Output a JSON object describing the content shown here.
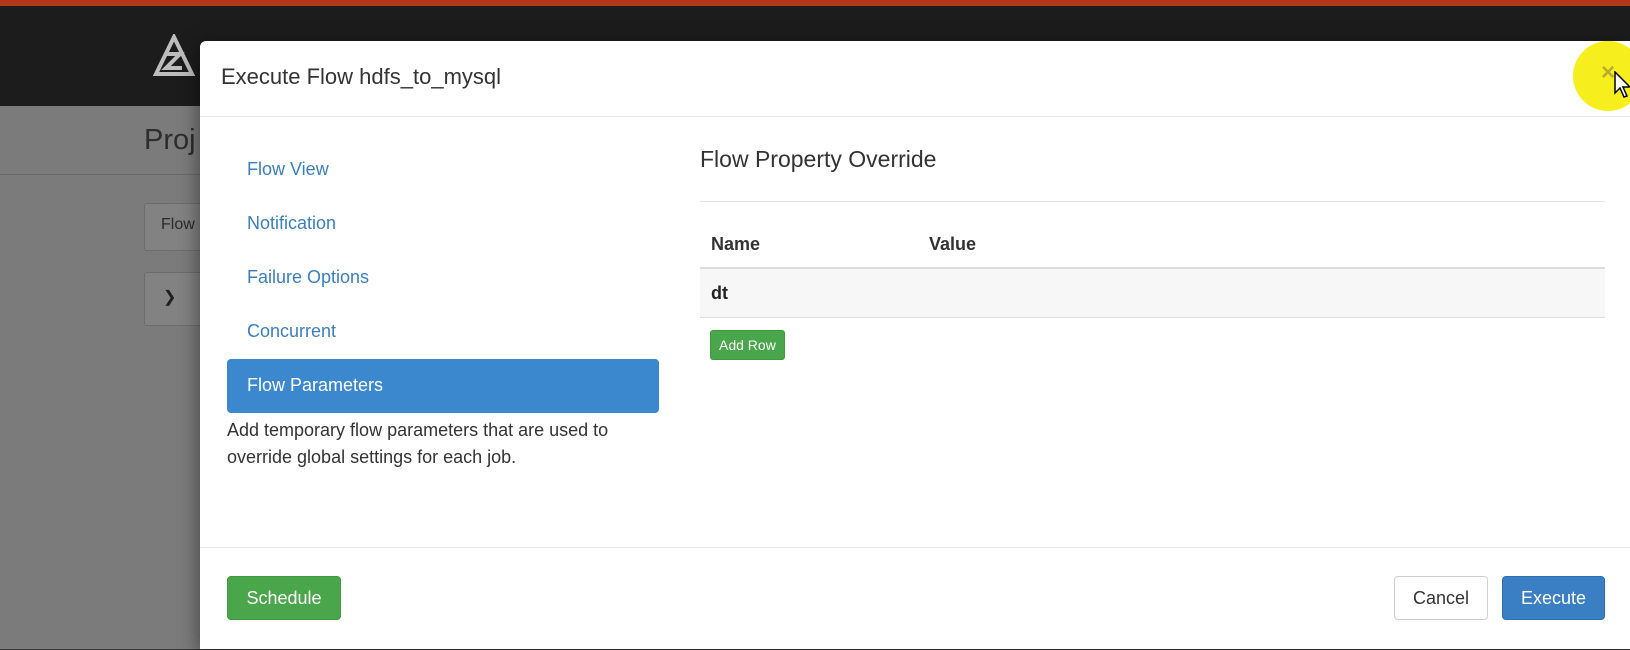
{
  "background": {
    "page_title": "Proj",
    "tab_label": "Flow"
  },
  "modal": {
    "title": "Execute Flow hdfs_to_mysql",
    "close_label": "×",
    "nav": [
      {
        "label": "Flow View"
      },
      {
        "label": "Notification"
      },
      {
        "label": "Failure Options"
      },
      {
        "label": "Concurrent"
      },
      {
        "label": "Flow Parameters",
        "active": true
      }
    ],
    "nav_help": "Add temporary flow parameters that are used to override global settings for each job.",
    "content": {
      "title": "Flow Property Override",
      "columns": [
        "Name",
        "Value"
      ],
      "rows": [
        {
          "name": "dt",
          "value": ""
        }
      ],
      "add_row_label": "Add Row"
    },
    "footer": {
      "schedule_label": "Schedule",
      "cancel_label": "Cancel",
      "execute_label": "Execute"
    }
  },
  "colors": {
    "accent_blue": "#3b88cf",
    "success_green": "#4aa64a",
    "top_stripe": "#b2361a",
    "cursor_highlight": "#f7ee1e"
  }
}
